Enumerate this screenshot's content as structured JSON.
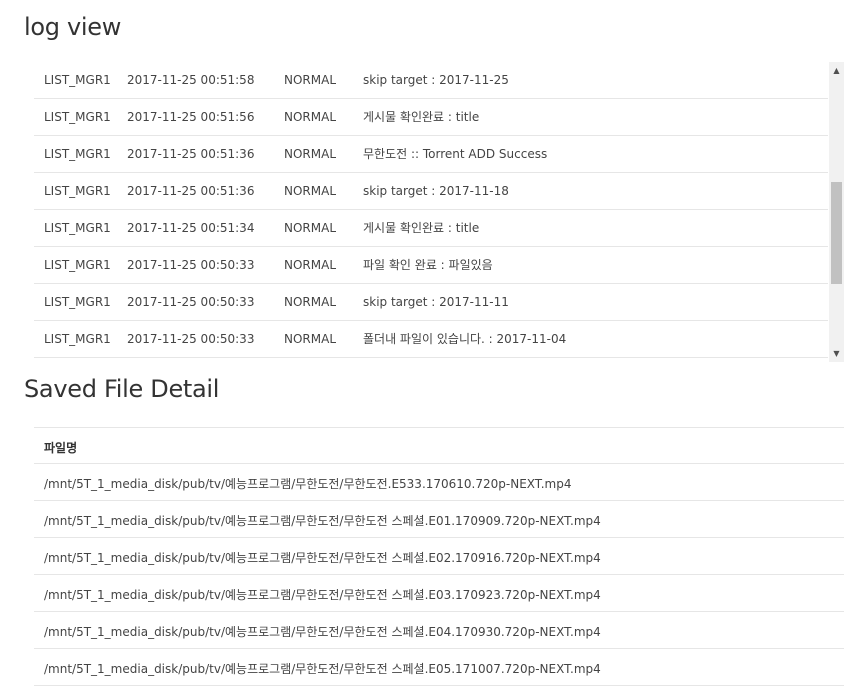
{
  "log_view": {
    "title": "log view",
    "rows": [
      {
        "source": "LIST_MGR1",
        "time": "2017-11-25 00:51:58",
        "level": "NORMAL",
        "message": "skip target : 2017-11-25"
      },
      {
        "source": "LIST_MGR1",
        "time": "2017-11-25 00:51:56",
        "level": "NORMAL",
        "message": "게시물 확인완료 : title"
      },
      {
        "source": "LIST_MGR1",
        "time": "2017-11-25 00:51:36",
        "level": "NORMAL",
        "message": "무한도전 :: Torrent ADD Success"
      },
      {
        "source": "LIST_MGR1",
        "time": "2017-11-25 00:51:36",
        "level": "NORMAL",
        "message": "skip target : 2017-11-18"
      },
      {
        "source": "LIST_MGR1",
        "time": "2017-11-25 00:51:34",
        "level": "NORMAL",
        "message": "게시물 확인완료 : title"
      },
      {
        "source": "LIST_MGR1",
        "time": "2017-11-25 00:50:33",
        "level": "NORMAL",
        "message": "파일 확인 완료 : 파일있음"
      },
      {
        "source": "LIST_MGR1",
        "time": "2017-11-25 00:50:33",
        "level": "NORMAL",
        "message": "skip target : 2017-11-11"
      },
      {
        "source": "LIST_MGR1",
        "time": "2017-11-25 00:50:33",
        "level": "NORMAL",
        "message": "폴더내 파일이 있습니다. : 2017-11-04"
      }
    ],
    "scrollbar": {
      "up_icon": "▲",
      "down_icon": "▼"
    }
  },
  "saved_file_detail": {
    "title": "Saved File Detail",
    "column_header": "파일명",
    "files": [
      "/mnt/5T_1_media_disk/pub/tv/예능프로그램/무한도전/무한도전.E533.170610.720p-NEXT.mp4",
      "/mnt/5T_1_media_disk/pub/tv/예능프로그램/무한도전/무한도전 스페셜.E01.170909.720p-NEXT.mp4",
      "/mnt/5T_1_media_disk/pub/tv/예능프로그램/무한도전/무한도전 스페셜.E02.170916.720p-NEXT.mp4",
      "/mnt/5T_1_media_disk/pub/tv/예능프로그램/무한도전/무한도전 스페셜.E03.170923.720p-NEXT.mp4",
      "/mnt/5T_1_media_disk/pub/tv/예능프로그램/무한도전/무한도전 스페셜.E04.170930.720p-NEXT.mp4",
      "/mnt/5T_1_media_disk/pub/tv/예능프로그램/무한도전/무한도전 스페셜.E05.171007.720p-NEXT.mp4"
    ]
  }
}
